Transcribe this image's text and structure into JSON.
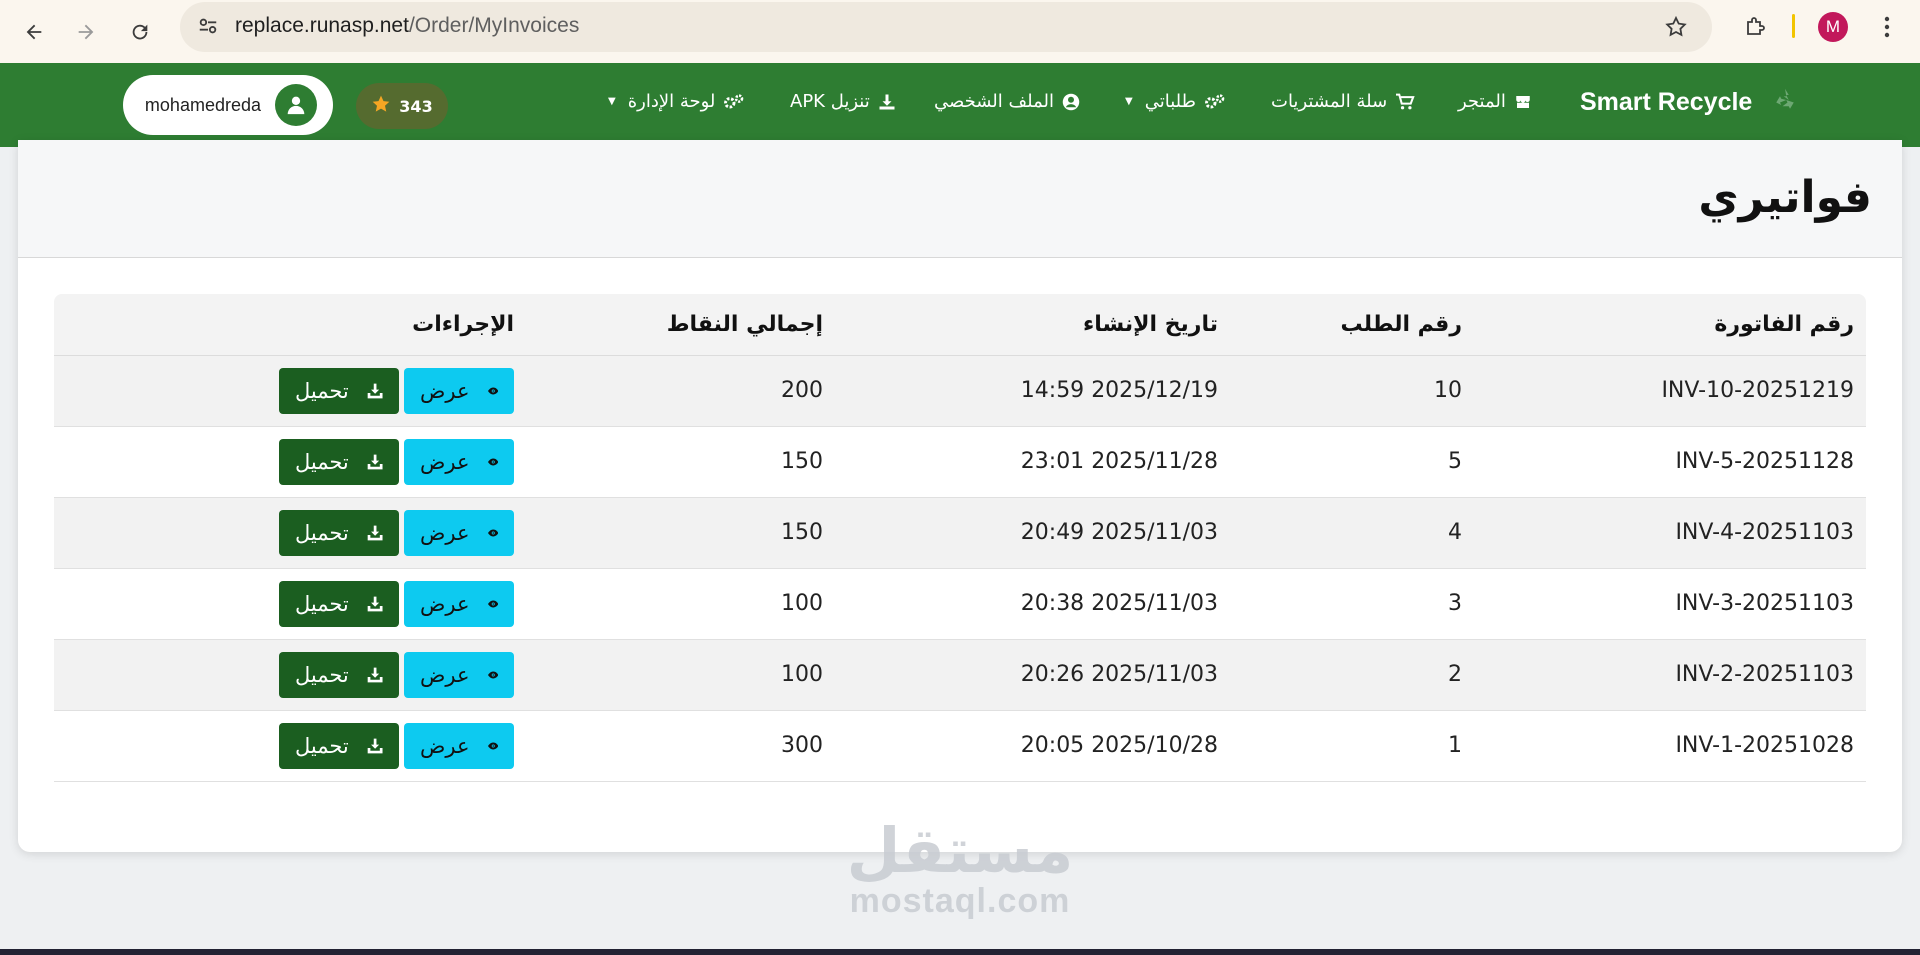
{
  "browser": {
    "url_domain": "replace.runasp.net",
    "url_path": "/Order/MyInvoices",
    "profile_initial": "M"
  },
  "navbar": {
    "brand": "Smart Recycle",
    "items": [
      {
        "label": "المتجر",
        "icon": "store-icon"
      },
      {
        "label": "سلة المشتريات",
        "icon": "cart-icon"
      },
      {
        "label": "طلباتي",
        "icon": "gears-icon",
        "dropdown": true
      },
      {
        "label": "الملف الشخصي",
        "icon": "user-circle-icon"
      },
      {
        "label": "تنزيل APK",
        "icon": "download-icon"
      },
      {
        "label": "لوحة الإدارة",
        "icon": "gears-icon",
        "dropdown": true
      }
    ],
    "points": "343",
    "username": "mohamedreda"
  },
  "page": {
    "title": "فواتيري"
  },
  "table": {
    "headers": {
      "invoice": "رقم الفاتورة",
      "order": "رقم الطلب",
      "date": "تاريخ الإنشاء",
      "points": "إجمالي النقاط",
      "actions": "الإجراءات"
    },
    "view_label": "عرض",
    "download_label": "تحميل",
    "rows": [
      {
        "invoice": "INV-10-20251219",
        "order": "10",
        "date": "2025/12/19 14:59",
        "points": "200"
      },
      {
        "invoice": "INV-5-20251128",
        "order": "5",
        "date": "2025/11/28 23:01",
        "points": "150"
      },
      {
        "invoice": "INV-4-20251103",
        "order": "4",
        "date": "2025/11/03 20:49",
        "points": "150"
      },
      {
        "invoice": "INV-3-20251103",
        "order": "3",
        "date": "2025/11/03 20:38",
        "points": "100"
      },
      {
        "invoice": "INV-2-20251103",
        "order": "2",
        "date": "2025/11/03 20:26",
        "points": "100"
      },
      {
        "invoice": "INV-1-20251028",
        "order": "1",
        "date": "2025/10/28 20:05",
        "points": "300"
      }
    ]
  },
  "watermark": {
    "arabic": "مستقل",
    "latin": "mostaql.com"
  },
  "colors": {
    "navbar": "#2e7d32",
    "view_button": "#0dcaf0",
    "download_button": "#1b5e20"
  }
}
